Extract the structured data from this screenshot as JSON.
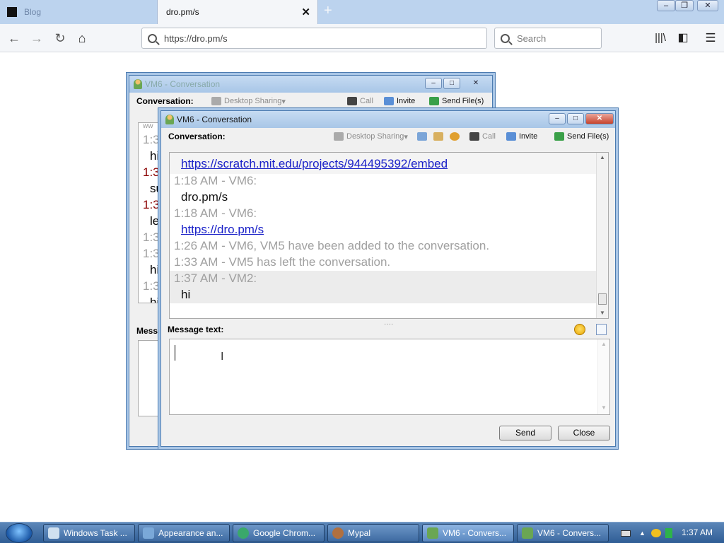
{
  "browser": {
    "tab1_title": "Blog",
    "tab2_title": "dro.pm/s",
    "url": "https://dro.pm/s",
    "search_placeholder": "Search"
  },
  "back_window": {
    "title": "VM6 - Conversation",
    "conversation_label": "Conversation:",
    "toolbar": [
      "Desktop Sharing",
      "Call",
      "Invite",
      "Send File(s)"
    ],
    "log_fragments": [
      "ww",
      "1:3",
      "hi",
      "1:3",
      "su",
      "1:3",
      "le",
      "1:3",
      "1:3",
      "hi",
      "1:3",
      "hi"
    ],
    "message_label_fragment": "Messa"
  },
  "front_window": {
    "title": "VM6 - Conversation",
    "conversation_label": "Conversation:",
    "toolbar": {
      "desktop_sharing": "Desktop Sharing",
      "call": "Call",
      "invite": "Invite",
      "send_files": "Send File(s)"
    },
    "chat": [
      {
        "kind": "link",
        "text": "https://scratch.mit.edu/projects/944495392/embed"
      },
      {
        "kind": "ts",
        "text": "1:18 AM - VM6:"
      },
      {
        "kind": "msg",
        "text": "dro.pm/s"
      },
      {
        "kind": "ts",
        "text": "1:18 AM - VM6:"
      },
      {
        "kind": "link",
        "text": "https://dro.pm/s"
      },
      {
        "kind": "ts",
        "text": "1:26 AM - VM6, VM5 have been added to the conversation."
      },
      {
        "kind": "ts",
        "text": "1:33 AM - VM5 has left the conversation."
      },
      {
        "kind": "ts",
        "text": "1:37 AM - VM2:"
      },
      {
        "kind": "msg",
        "text": "hi"
      }
    ],
    "message_label": "Message text:",
    "message_value": "",
    "send_label": "Send",
    "close_label": "Close"
  },
  "taskbar": {
    "tasks": [
      "Windows Task ...",
      "Appearance an...",
      "Google Chrom...",
      "Mypal",
      "VM6 - Convers...",
      "VM6 - Convers..."
    ],
    "clock": "1:37 AM"
  },
  "colors": {
    "link": "#1a21c8",
    "timestamp": "#a0a0a0",
    "titlebar": "#a8c6e7",
    "taskbar": "#2f5d95"
  }
}
